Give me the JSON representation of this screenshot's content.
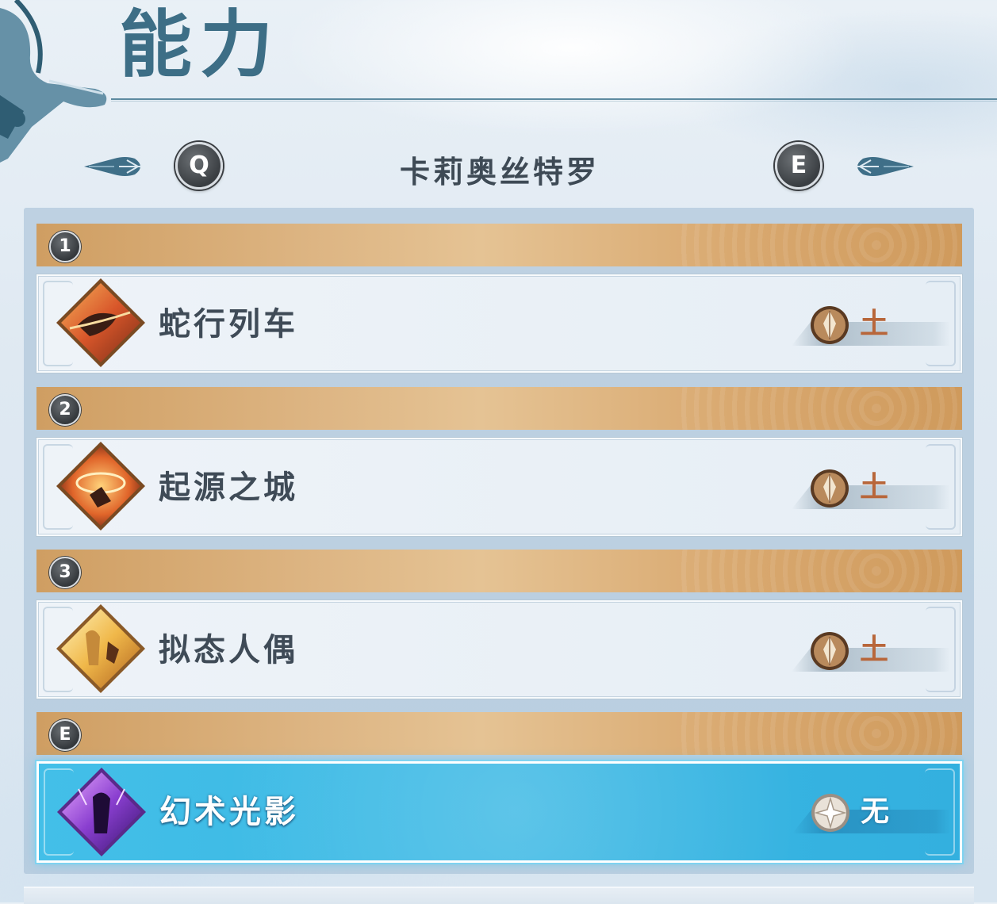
{
  "header": {
    "title": "能力"
  },
  "character_switcher": {
    "prev_key": "Q",
    "next_key": "E",
    "character_name": "卡莉奥丝特罗"
  },
  "slots": [
    {
      "slot_label": "1",
      "ability_name": "蛇行列车",
      "element": "土",
      "element_icon": "earth-crystal-icon",
      "selected": false
    },
    {
      "slot_label": "2",
      "ability_name": "起源之城",
      "element": "土",
      "element_icon": "earth-crystal-icon",
      "selected": false
    },
    {
      "slot_label": "3",
      "ability_name": "拟态人偶",
      "element": "土",
      "element_icon": "earth-crystal-icon",
      "selected": false
    },
    {
      "slot_label": "E",
      "ability_name": "幻术光影",
      "element": "无",
      "element_icon": "neutral-star-icon",
      "selected": true
    }
  ],
  "colors": {
    "title": "#3d6e86",
    "slot_header": "#d9a970",
    "selected_row": "#3ab8e4",
    "element_text": "#b8663a"
  }
}
